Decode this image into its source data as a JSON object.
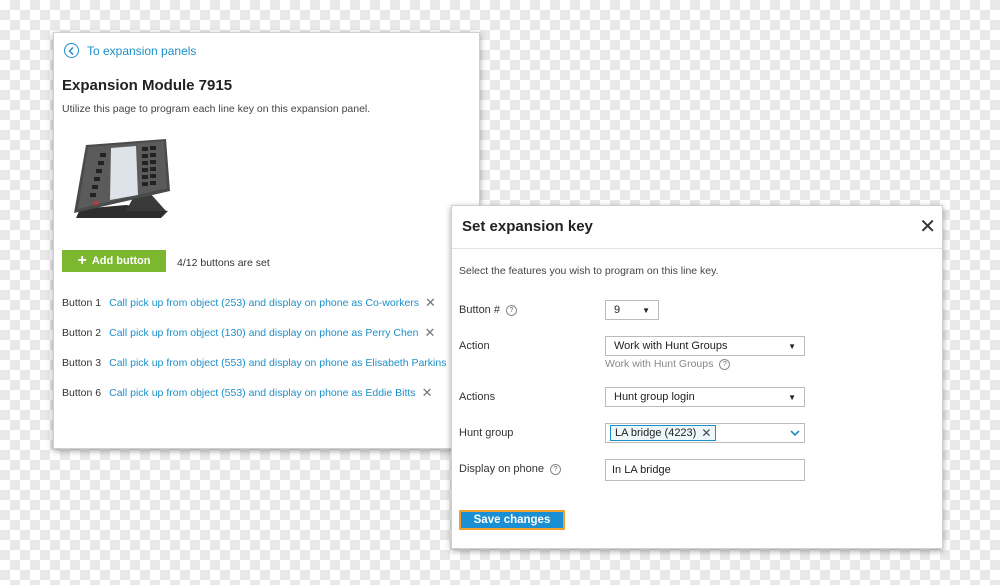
{
  "left": {
    "back_label": "To expansion panels",
    "title": "Expansion Module 7915",
    "description": "Utilize this page to program each line key on this expansion panel.",
    "add_button_label": "Add button",
    "buttons_status": "4/12 buttons are set",
    "button_rows": [
      {
        "label": "Button 1",
        "text": "Call pick up from object (253) and display on phone as Co-workers"
      },
      {
        "label": "Button 2",
        "text": "Call pick up from object (130) and display on phone as Perry Chen"
      },
      {
        "label": "Button 3",
        "text": "Call pick up from object (553) and display on phone as Elisabeth Parkins"
      },
      {
        "label": "Button 6",
        "text": "Call pick up from object (553) and display on phone as Eddie Bitts"
      }
    ]
  },
  "dialog": {
    "title": "Set expansion key",
    "description": "Select the features you wish to program on this line key.",
    "button_no_label": "Button #",
    "button_no_value": "9",
    "action_label": "Action",
    "action_value": "Work with Hunt Groups",
    "action_hint": "Work with Hunt Groups",
    "actions_label": "Actions",
    "actions_value": "Hunt group login",
    "hunt_group_label": "Hunt group",
    "hunt_group_tag": "LA bridge (4223)",
    "display_label": "Display on phone",
    "display_value": "In LA bridge",
    "save_label": "Save changes"
  },
  "colors": {
    "accent": "#1d8fc9",
    "add_button": "#7cb82f",
    "save_button": "#1b8fd4",
    "save_border": "#f0a030"
  }
}
